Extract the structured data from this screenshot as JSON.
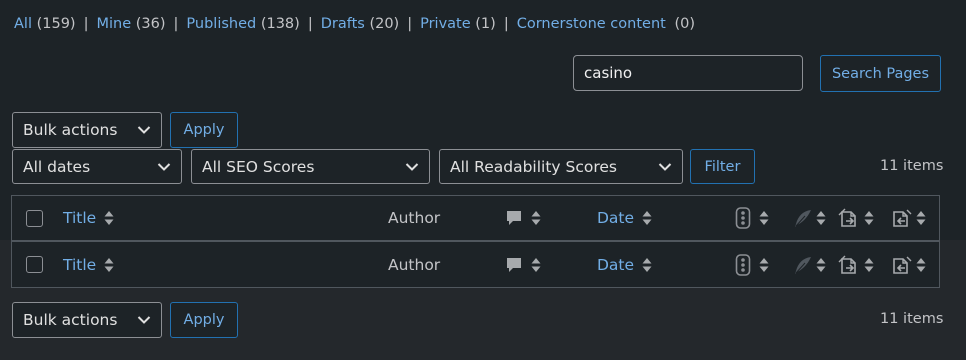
{
  "filters": {
    "all": {
      "label": "All",
      "count": "(159)"
    },
    "mine": {
      "label": "Mine",
      "count": "(36)"
    },
    "published": {
      "label": "Published",
      "count": "(138)"
    },
    "drafts": {
      "label": "Drafts",
      "count": "(20)"
    },
    "private": {
      "label": "Private",
      "count": "(1)"
    },
    "cornerstone": {
      "label": "Cornerstone content",
      "count": "(0)"
    },
    "separator": "|"
  },
  "search": {
    "value": "casino",
    "button_label": "Search Pages"
  },
  "bulk_top": {
    "selected": "Bulk actions",
    "apply_label": "Apply"
  },
  "bulk_bottom": {
    "selected": "Bulk actions",
    "apply_label": "Apply"
  },
  "dates_filter": {
    "selected": "All dates"
  },
  "seo_filter": {
    "selected": "All SEO Scores"
  },
  "readability_filter": {
    "selected": "All Readability Scores"
  },
  "filter_button": "Filter",
  "items_count_top": "11 items",
  "items_count_bottom": "11 items",
  "columns": {
    "title": "Title",
    "author": "Author",
    "date": "Date"
  },
  "icons": {
    "comments": "comment-bubble-icon",
    "seo": "traffic-light-icon",
    "readability": "feather-icon",
    "outgoing_links": "outgoing-links-icon",
    "incoming_links": "incoming-links-icon",
    "sort": "sort-arrows-icon",
    "chevron": "chevron-down-icon"
  },
  "colors": {
    "background": "#1d2327",
    "link": "#72aee6",
    "border": "#50575e",
    "button_border": "#2271b1"
  }
}
